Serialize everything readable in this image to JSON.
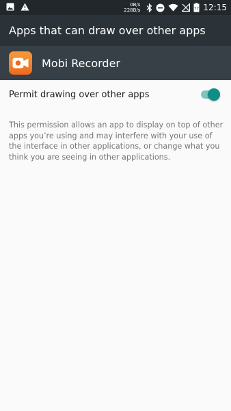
{
  "status_bar": {
    "net_up": "0B/s",
    "net_down": "228B/s",
    "time": "12:15",
    "icons": [
      "image-icon",
      "warning-icon",
      "bluetooth-icon",
      "do-not-disturb-icon",
      "wifi-icon",
      "no-signal-icon",
      "battery-icon"
    ],
    "battery_label": "77"
  },
  "toolbar": {
    "title": "Apps that can draw over other apps"
  },
  "app": {
    "name": "Mobi Recorder",
    "icon": "mobi-recorder-app-icon"
  },
  "setting": {
    "label": "Permit drawing over other apps",
    "enabled": true
  },
  "description": {
    "text": "This permission allows an app to display on top of other apps you’re using and may interfere with your use of the interface in other applications, or change what you think you are seeing in other applications."
  },
  "colors": {
    "status_bar_bg": "#21272b",
    "toolbar_bg": "#2c3338",
    "app_header_bg": "#374046",
    "accent": "#0e8e84",
    "switch_track": "#7fc5be",
    "app_icon": "#f58a2e"
  }
}
